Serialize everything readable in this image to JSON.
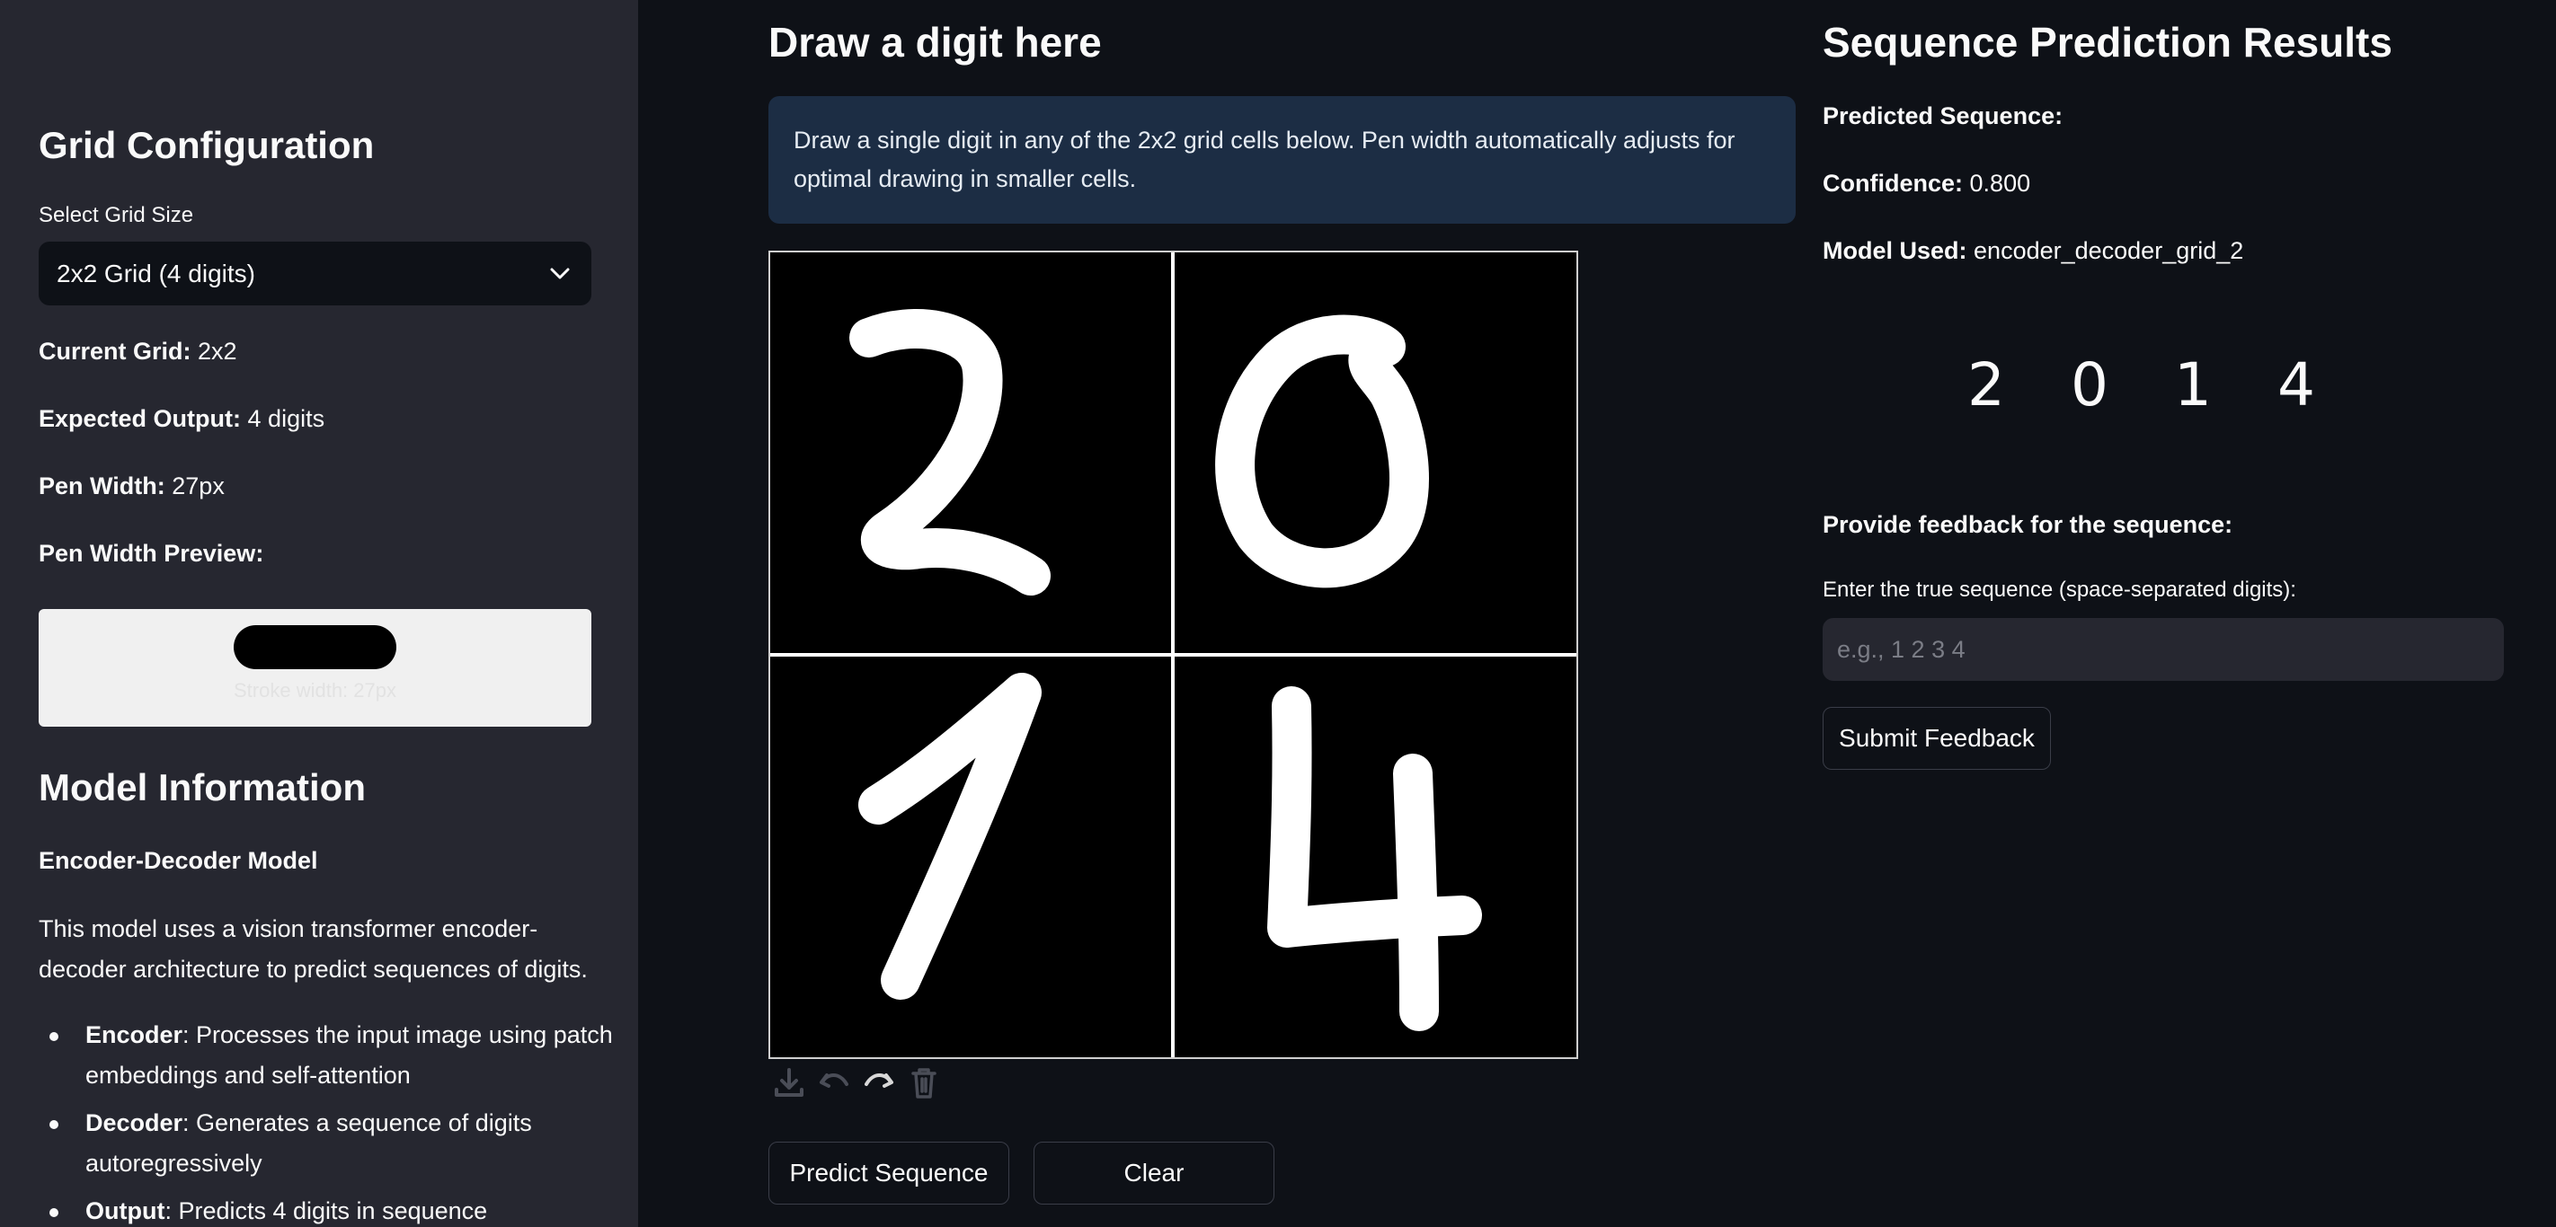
{
  "sidebar": {
    "grid_config_title": "Grid Configuration",
    "select_label": "Select Grid Size",
    "select_value": "2x2 Grid (4 digits)",
    "current_grid_label": "Current Grid:",
    "current_grid_value": "2x2",
    "expected_output_label": "Expected Output:",
    "expected_output_value": "4 digits",
    "pen_width_label": "Pen Width:",
    "pen_width_value": "27px",
    "pen_preview_label": "Pen Width Preview:",
    "pen_preview_caption": "Stroke width: 27px",
    "model_info_title": "Model Information",
    "model_name": "Encoder-Decoder Model",
    "model_description": "This model uses a vision transformer encoder-decoder architecture to predict sequences of digits.",
    "bullets": [
      {
        "term": "Encoder",
        "text": ": Processes the input image using patch embeddings and self-attention"
      },
      {
        "term": "Decoder",
        "text": ": Generates a sequence of digits autoregressively"
      },
      {
        "term": "Output",
        "text": ": Predicts 4 digits in sequence"
      }
    ]
  },
  "main": {
    "title": "Draw a digit here",
    "info": "Draw a single digit in any of the 2x2 grid cells below. Pen width automatically adjusts for optimal drawing in smaller cells.",
    "toolbar_icons": [
      "download-icon",
      "undo-icon",
      "redo-icon",
      "trash-icon"
    ],
    "predict_button": "Predict Sequence",
    "clear_button": "Clear"
  },
  "results": {
    "title": "Sequence Prediction Results",
    "predicted_sequence_label": "Predicted Sequence:",
    "confidence_label": "Confidence:",
    "confidence_value": "0.800",
    "model_used_label": "Model Used:",
    "model_used_value": "encoder_decoder_grid_2",
    "digits": [
      "2",
      "0",
      "1",
      "4"
    ],
    "feedback_title": "Provide feedback for the sequence:",
    "feedback_input_label": "Enter the true sequence (space-separated digits):",
    "feedback_placeholder": "e.g., 1 2 3 4",
    "submit_button": "Submit Feedback"
  },
  "colors": {
    "background": "#0e1117",
    "sidebar": "#262730",
    "info_box": "#1c2d44",
    "text": "#fafafa"
  }
}
